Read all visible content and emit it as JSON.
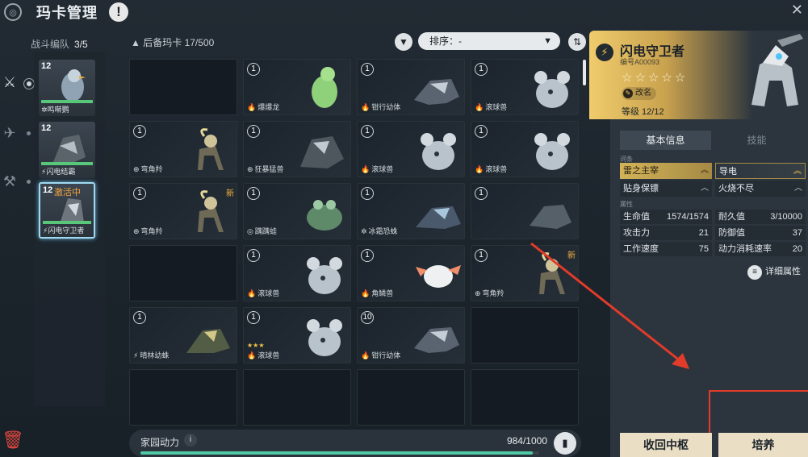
{
  "header": {
    "title": "玛卡管理",
    "warn_glyph": "!",
    "close_glyph": "✕",
    "logo_glyph": "◎"
  },
  "team": {
    "label": "战斗编队",
    "count": "3/5",
    "cards": [
      {
        "level": "12",
        "name": "鸣啭鹦",
        "elem": "✲",
        "active": ""
      },
      {
        "level": "12",
        "name": "闪电结霸",
        "elem": "⚡",
        "active": ""
      },
      {
        "level": "12",
        "name": "闪电守卫者",
        "elem": "⚡",
        "active": "激活中"
      }
    ]
  },
  "grid": {
    "title": "后备玛卡",
    "count": "17/500",
    "sort_label": "排序：-",
    "cells": [
      {
        "level": "",
        "name": "",
        "elem": "",
        "new": "",
        "stars": ""
      },
      {
        "level": "1",
        "name": "爆爆龙",
        "elem": "🔥",
        "new": "",
        "stars": ""
      },
      {
        "level": "1",
        "name": "钳行幼体",
        "elem": "🔥",
        "new": "",
        "stars": ""
      },
      {
        "level": "1",
        "name": "滚球兽",
        "elem": "🔥",
        "new": "",
        "stars": ""
      },
      {
        "level": "1",
        "name": "弯角羚",
        "elem": "⊕",
        "new": "",
        "stars": ""
      },
      {
        "level": "1",
        "name": "狂暴猛兽",
        "elem": "⊕",
        "new": "",
        "stars": ""
      },
      {
        "level": "1",
        "name": "滚球兽",
        "elem": "🔥",
        "new": "",
        "stars": ""
      },
      {
        "level": "1",
        "name": "滚球兽",
        "elem": "🔥",
        "new": "",
        "stars": ""
      },
      {
        "level": "1",
        "name": "弯角羚",
        "elem": "⊕",
        "new": "新",
        "stars": ""
      },
      {
        "level": "1",
        "name": "蹒蹒蛙",
        "elem": "◎",
        "new": "",
        "stars": ""
      },
      {
        "level": "1",
        "name": "冰霜恐蛛",
        "elem": "✲",
        "new": "",
        "stars": ""
      },
      {
        "level": "1",
        "name": "",
        "elem": "",
        "new": "",
        "stars": ""
      },
      {
        "level": "",
        "name": "",
        "elem": "",
        "new": "",
        "stars": ""
      },
      {
        "level": "1",
        "name": "滚球兽",
        "elem": "🔥",
        "new": "",
        "stars": ""
      },
      {
        "level": "1",
        "name": "角鳞兽",
        "elem": "🔥",
        "new": "",
        "stars": ""
      },
      {
        "level": "1",
        "name": "弯角羚",
        "elem": "⊕",
        "new": "新",
        "stars": ""
      },
      {
        "level": "1",
        "name": "晴林幼蛛",
        "elem": "⚡",
        "new": "",
        "stars": ""
      },
      {
        "level": "1",
        "name": "滚球兽",
        "elem": "🔥",
        "new": "",
        "stars": "★★★"
      },
      {
        "level": "10",
        "name": "钳行幼体",
        "elem": "🔥",
        "new": "",
        "stars": ""
      },
      {
        "level": "",
        "name": "",
        "elem": "",
        "new": "",
        "stars": ""
      },
      {
        "level": "",
        "name": "",
        "elem": "",
        "new": "",
        "stars": ""
      },
      {
        "level": "",
        "name": "",
        "elem": "",
        "new": "",
        "stars": ""
      },
      {
        "level": "",
        "name": "",
        "elem": "",
        "new": "",
        "stars": ""
      },
      {
        "level": "",
        "name": "",
        "elem": "",
        "new": "",
        "stars": ""
      }
    ]
  },
  "energy": {
    "label": "家园动力",
    "value": "984/1000",
    "fraction": 0.984
  },
  "detail": {
    "name": "闪电守卫者",
    "code": "编号A00093",
    "stars": "☆☆☆☆☆",
    "rename": "改名",
    "level": "等级 12/12",
    "tabs": [
      "基本信息",
      "技能"
    ],
    "traits_label": "词条",
    "attrs_label": "属性",
    "traits": [
      "雷之主宰",
      "导电",
      "贴身保镖",
      "火烧不尽"
    ],
    "stats": [
      {
        "k": "生命值",
        "v": "1574/1574"
      },
      {
        "k": "耐久值",
        "v": "3/10000"
      },
      {
        "k": "攻击力",
        "v": "21"
      },
      {
        "k": "防御值",
        "v": "37"
      },
      {
        "k": "工作速度",
        "v": "75"
      },
      {
        "k": "动力消耗速率",
        "v": "20"
      }
    ],
    "more": "详细属性"
  },
  "buttons": {
    "recall": "收回中枢",
    "train": "培养"
  },
  "colors": {
    "accent_gold": "#f0cc6c",
    "energy": "#52c9a6",
    "highlight": "#e23b2a"
  }
}
